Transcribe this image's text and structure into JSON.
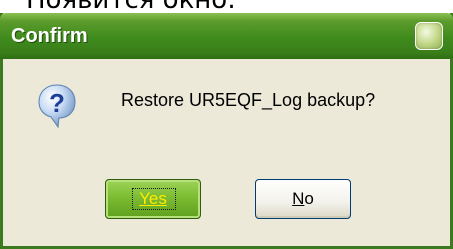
{
  "window": {
    "top_caption": "Появится окно:",
    "title": "Confirm",
    "message": "Restore UR5EQF_Log backup?"
  },
  "buttons": {
    "yes_label": "Yes",
    "no_first": "N",
    "no_rest": "o"
  },
  "colors": {
    "titlebar": "#3f8a1c",
    "dialog_bg": "#ece9d8",
    "yes_bg": "#7fbf35",
    "yes_text": "#ffea00"
  },
  "icons": {
    "dialog_icon": "question-icon",
    "title_button": "title-corner-button"
  }
}
